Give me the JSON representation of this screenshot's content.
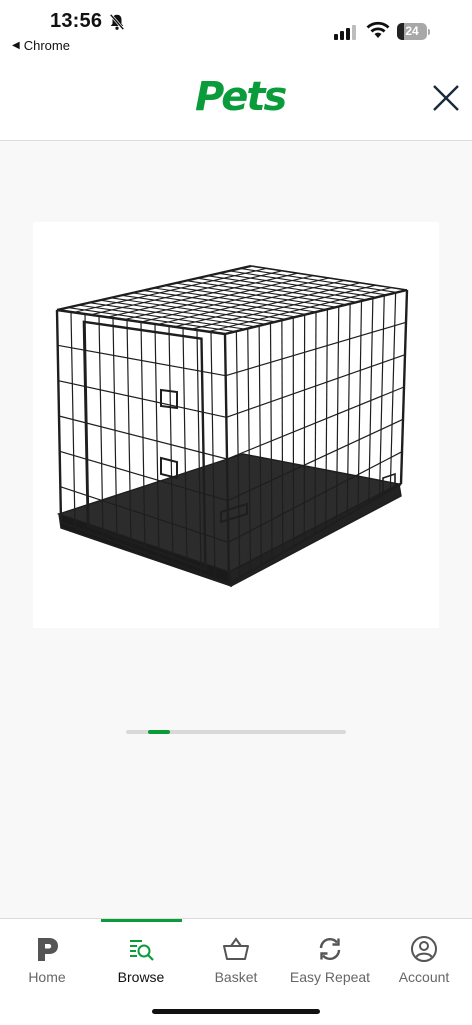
{
  "status_bar": {
    "time": "13:56",
    "back_app": "Chrome",
    "battery_percent": "24",
    "icons": [
      "bell-slash-icon",
      "signal-icon",
      "wifi-icon",
      "battery-icon"
    ]
  },
  "header": {
    "logo_text": "Pets",
    "close_icon": "close-icon",
    "brand_color": "#0a9b3a"
  },
  "product": {
    "image_name": "dog-crate-product-image"
  },
  "carousel": {
    "active_index": 1,
    "indicator_color": "#0a9b3a"
  },
  "tabs": [
    {
      "label": "Home",
      "icon": "pets-p-logo-icon",
      "active": false
    },
    {
      "label": "Browse",
      "icon": "browse-search-icon",
      "active": true
    },
    {
      "label": "Basket",
      "icon": "basket-icon",
      "active": false
    },
    {
      "label": "Easy Repeat",
      "icon": "repeat-icon",
      "active": false
    },
    {
      "label": "Account",
      "icon": "account-icon",
      "active": false
    }
  ]
}
